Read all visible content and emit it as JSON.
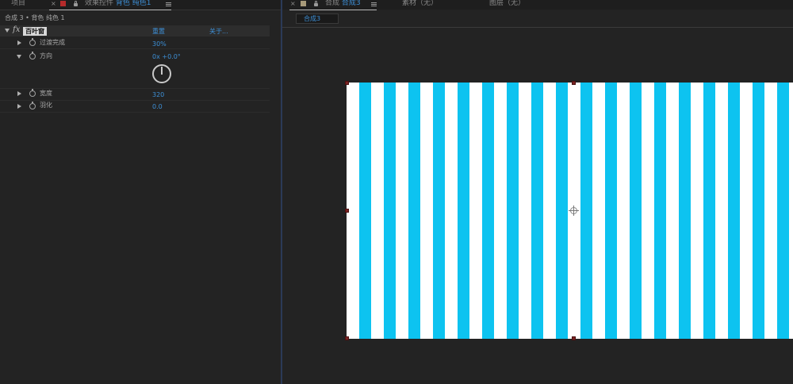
{
  "left_panel": {
    "project_tab": "项目",
    "effects_tab_prefix": "效果控件",
    "effects_tab_layer": "背色 纯色1",
    "breadcrumb": "合成 3 • 背色 纯色 1",
    "effect": {
      "name": "百叶窗",
      "reset_label": "重置",
      "about_label": "关于..."
    },
    "properties": [
      {
        "label": "过渡完成",
        "value": "30%"
      },
      {
        "label": "方向",
        "value": "0x +0.0°"
      },
      {
        "label": "宽度",
        "value": "320"
      },
      {
        "label": "羽化",
        "value": "0.0"
      }
    ],
    "direction_value": "0x +0.0°"
  },
  "right_panel": {
    "comp_tab_prefix": "合成",
    "comp_tab_name": "合成3",
    "footage_tab": "素材（无）",
    "layer_tab": "图层（无）",
    "comp_subtab": "合成3"
  },
  "colors": {
    "stripe_white": "#ffffff",
    "stripe_cyan": "#0dc3f0",
    "accent_blue": "#3d8fd6",
    "close_red": "#b62b2b"
  },
  "icons": {
    "close": "close-icon",
    "lock": "lock-icon",
    "menu": "hamburger-menu-icon",
    "stopwatch": "stopwatch-icon",
    "expand": "triangle-icon",
    "anchor": "anchor-point-icon"
  }
}
